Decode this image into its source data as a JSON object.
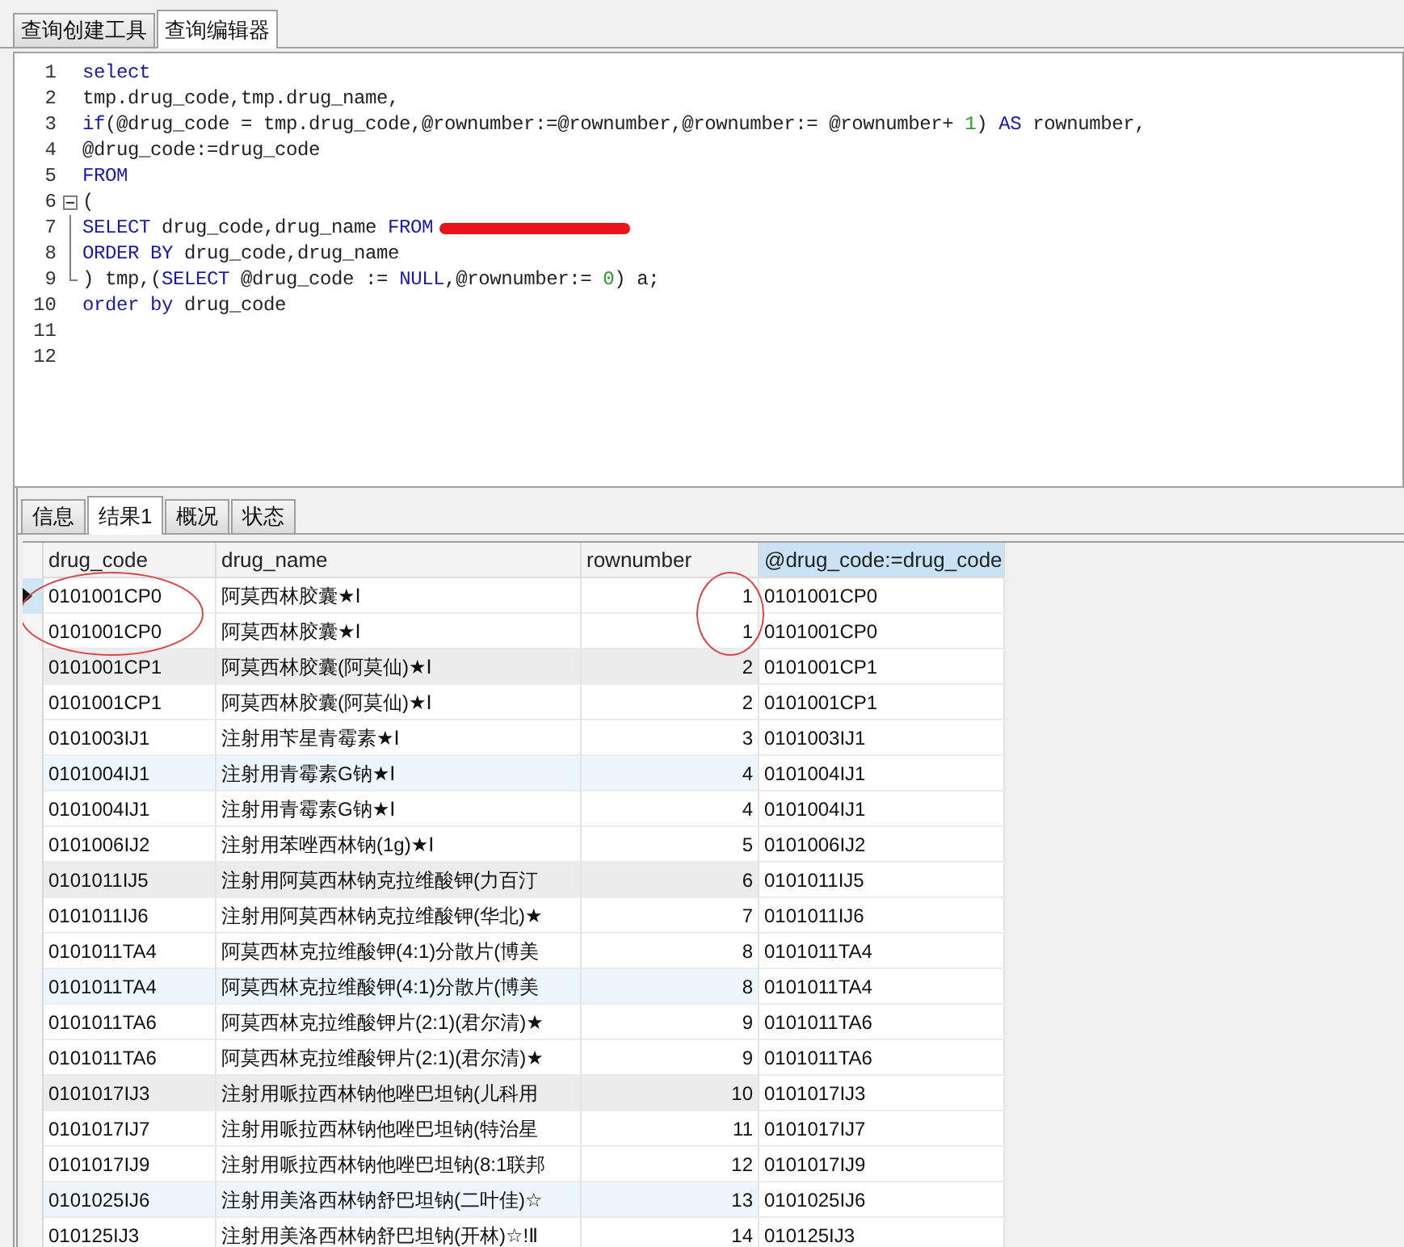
{
  "top_tabs": [
    {
      "label": "查询创建工具",
      "selected": false
    },
    {
      "label": "查询编辑器",
      "selected": true
    }
  ],
  "editor": {
    "lines": [
      {
        "number": "1",
        "tokens": [
          {
            "text": "select",
            "kind": "keyword"
          }
        ]
      },
      {
        "number": "2",
        "tokens": [
          {
            "text": "tmp.drug_code,tmp.drug_name,",
            "kind": "plain"
          }
        ]
      },
      {
        "number": "3",
        "tokens": [
          {
            "text": "if",
            "kind": "keyword"
          },
          {
            "text": "(@drug_code = tmp.drug_code,@rownumber:=@rownumber,@rownumber:= @rownumber+ ",
            "kind": "plain"
          },
          {
            "text": "1",
            "kind": "number"
          },
          {
            "text": ") ",
            "kind": "plain"
          },
          {
            "text": "AS",
            "kind": "keyword"
          },
          {
            "text": " rownumber,",
            "kind": "plain"
          }
        ]
      },
      {
        "number": "4",
        "tokens": [
          {
            "text": "@drug_code:=drug_code",
            "kind": "plain"
          }
        ]
      },
      {
        "number": "5",
        "tokens": [
          {
            "text": "FROM",
            "kind": "keyword"
          }
        ]
      },
      {
        "number": "6",
        "expanded": true,
        "tokens": [
          {
            "text": "(",
            "kind": "plain"
          }
        ]
      },
      {
        "number": "7",
        "redacted": true,
        "tokens": [
          {
            "text": "SELECT",
            "kind": "keyword"
          },
          {
            "text": " drug_code,drug_name ",
            "kind": "plain"
          },
          {
            "text": "FROM",
            "kind": "keyword"
          }
        ]
      },
      {
        "number": "8",
        "tokens": [
          {
            "text": "ORDER BY",
            "kind": "keyword"
          },
          {
            "text": " drug_code,drug_name",
            "kind": "plain"
          }
        ]
      },
      {
        "number": "9",
        "fold_end": true,
        "tokens": [
          {
            "text": ") tmp,(",
            "kind": "plain"
          },
          {
            "text": "SELECT",
            "kind": "keyword"
          },
          {
            "text": " @drug_code := ",
            "kind": "plain"
          },
          {
            "text": "NULL",
            "kind": "keyword"
          },
          {
            "text": ",@rownumber:= ",
            "kind": "plain"
          },
          {
            "text": "0",
            "kind": "number"
          },
          {
            "text": ") a;",
            "kind": "plain"
          }
        ]
      },
      {
        "number": "10",
        "tokens": [
          {
            "text": "order by",
            "kind": "keyword"
          },
          {
            "text": " drug_code",
            "kind": "plain"
          }
        ]
      },
      {
        "number": "11"
      },
      {
        "number": "12"
      }
    ]
  },
  "result_tabs": [
    {
      "label": "信息",
      "selected": false
    },
    {
      "label": "结果1",
      "selected": true
    },
    {
      "label": "概况",
      "selected": false
    },
    {
      "label": "状态",
      "selected": false
    }
  ],
  "table": {
    "columns": [
      {
        "label": "drug_code",
        "kind": "text",
        "selected": false,
        "circled": true
      },
      {
        "label": "drug_name",
        "kind": "text",
        "selected": false
      },
      {
        "label": "rownumber",
        "kind": "number",
        "selected": false,
        "circled": true
      },
      {
        "label": "@drug_code:=drug_code",
        "kind": "text",
        "selected": true
      }
    ],
    "rows": [
      {
        "current": true,
        "circled": true,
        "cells": [
          "0101001CP0",
          "阿莫西林胶囊★Ⅰ",
          "1",
          "0101001CP0"
        ]
      },
      {
        "current": false,
        "circled": true,
        "cells": [
          "0101001CP0",
          "阿莫西林胶囊★Ⅰ",
          "1",
          "0101001CP0"
        ]
      },
      {
        "current": false,
        "circled": false,
        "color": "#ececec",
        "cells": [
          "0101001CP1",
          "阿莫西林胶囊(阿莫仙)★Ⅰ",
          "2",
          "0101001CP1"
        ]
      },
      {
        "current": false,
        "circled": false,
        "cells": [
          "0101001CP1",
          "阿莫西林胶囊(阿莫仙)★Ⅰ",
          "2",
          "0101001CP1"
        ]
      },
      {
        "current": false,
        "circled": false,
        "cells": [
          "0101003IJ1",
          "注射用苄星青霉素★Ⅰ",
          "3",
          "0101003IJ1"
        ]
      },
      {
        "current": false,
        "circled": false,
        "color": "#eef6fd",
        "cells": [
          "0101004IJ1",
          "注射用青霉素G钠★Ⅰ",
          "4",
          "0101004IJ1"
        ]
      },
      {
        "current": false,
        "circled": false,
        "cells": [
          "0101004IJ1",
          "注射用青霉素G钠★Ⅰ",
          "4",
          "0101004IJ1"
        ]
      },
      {
        "current": false,
        "circled": false,
        "cells": [
          "0101006IJ2",
          "注射用苯唑西林钠(1g)★Ⅰ",
          "5",
          "0101006IJ2"
        ]
      },
      {
        "current": false,
        "circled": false,
        "color": "#ececec",
        "cells": [
          "0101011IJ5",
          "注射用阿莫西林钠克拉维酸钾(力百汀",
          "6",
          "0101011IJ5"
        ]
      },
      {
        "current": false,
        "circled": false,
        "cells": [
          "0101011IJ6",
          "注射用阿莫西林钠克拉维酸钾(华北)★",
          "7",
          "0101011IJ6"
        ]
      },
      {
        "current": false,
        "circled": false,
        "cells": [
          "0101011TA4",
          "阿莫西林克拉维酸钾(4:1)分散片(博美",
          "8",
          "0101011TA4"
        ]
      },
      {
        "current": false,
        "circled": false,
        "color": "#eef6fd",
        "cells": [
          "0101011TA4",
          "阿莫西林克拉维酸钾(4:1)分散片(博美",
          "8",
          "0101011TA4"
        ]
      },
      {
        "current": false,
        "circled": false,
        "cells": [
          "0101011TA6",
          "阿莫西林克拉维酸钾片(2:1)(君尔清)★",
          "9",
          "0101011TA6"
        ]
      },
      {
        "current": false,
        "circled": false,
        "cells": [
          "0101011TA6",
          "阿莫西林克拉维酸钾片(2:1)(君尔清)★",
          "9",
          "0101011TA6"
        ]
      },
      {
        "current": false,
        "circled": false,
        "color": "#ececec",
        "cells": [
          "0101017IJ3",
          "注射用哌拉西林钠他唑巴坦钠(儿科用",
          "10",
          "0101017IJ3"
        ]
      },
      {
        "current": false,
        "circled": false,
        "cells": [
          "0101017IJ7",
          "注射用哌拉西林钠他唑巴坦钠(特治星",
          "11",
          "0101017IJ7"
        ]
      },
      {
        "current": false,
        "circled": false,
        "cells": [
          "0101017IJ9",
          "注射用哌拉西林钠他唑巴坦钠(8:1联邦",
          "12",
          "0101017IJ9"
        ]
      },
      {
        "current": false,
        "circled": false,
        "color": "#eef6fd",
        "cells": [
          "0101025IJ6",
          "注射用美洛西林钠舒巴坦钠(二叶佳)☆",
          "13",
          "0101025IJ6"
        ]
      },
      {
        "current": false,
        "circled": false,
        "cells": [
          "010125IJ3",
          "注射用美洛西林钠舒巴坦钠(开林)☆!Ⅱ",
          "14",
          "010125IJ3"
        ]
      }
    ]
  }
}
